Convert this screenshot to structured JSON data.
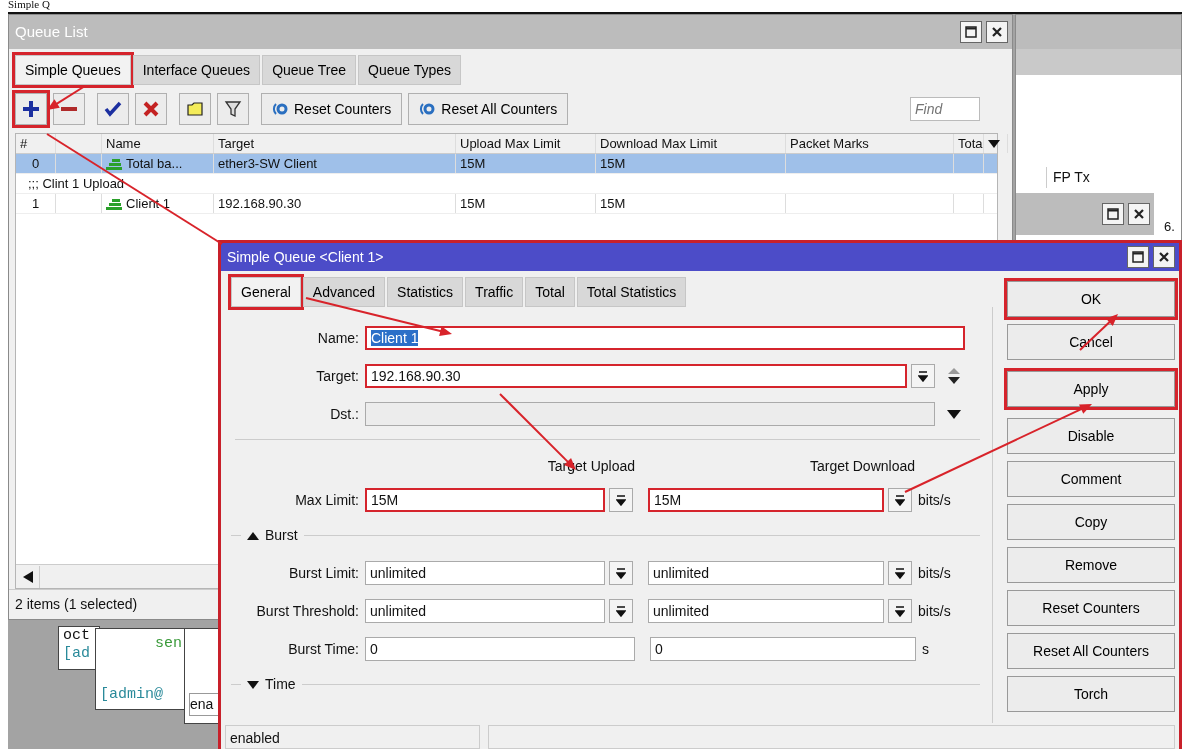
{
  "page_heading": "Simple Q",
  "queue_list": {
    "title": "Queue List",
    "tabs": [
      {
        "label": "Simple Queues",
        "selected": true,
        "highlighted": true
      },
      {
        "label": "Interface Queues",
        "selected": false,
        "highlighted": false
      },
      {
        "label": "Queue Tree",
        "selected": false,
        "highlighted": false
      },
      {
        "label": "Queue Types",
        "selected": false,
        "highlighted": false
      }
    ],
    "tools": [
      {
        "kind": "add",
        "highlighted": true
      },
      {
        "kind": "remove",
        "highlighted": false
      },
      {
        "kind": "enable",
        "highlighted": false
      },
      {
        "kind": "disable",
        "highlighted": false
      },
      {
        "kind": "comment",
        "highlighted": false
      },
      {
        "kind": "filter",
        "highlighted": false
      }
    ],
    "actions": [
      "Reset Counters",
      "Reset All Counters"
    ],
    "find": {
      "placeholder": "Find"
    },
    "columns": [
      "#",
      "Name",
      "Target",
      "Upload Max Limit",
      "Download Max Limit",
      "Packet Marks",
      "Tota"
    ],
    "rows": [
      {
        "kind": "entry",
        "number": "0",
        "name": "Total ba...",
        "target": "ether3-SW Client",
        "upload": "15M",
        "download": "15M",
        "selected": true
      },
      {
        "kind": "comment",
        "text": ";;; Clint 1 Upload",
        "selected": false
      },
      {
        "kind": "entry",
        "number": "1",
        "name": "Client 1",
        "target": "192.168.90.30",
        "upload": "15M",
        "download": "15M",
        "selected": false
      }
    ],
    "status": "2 items (1 selected)"
  },
  "side_window": {
    "column": "FP Tx",
    "value": "6."
  },
  "background_windows": [
    {
      "lines": [
        "oct",
        "[ad"
      ]
    },
    {
      "lines": [
        "sen",
        "[admin@"
      ]
    },
    {
      "lines": [
        "ena"
      ]
    }
  ],
  "dialog": {
    "title": "Simple Queue <Client 1>",
    "tabs": [
      {
        "label": "General",
        "selected": true,
        "highlighted": true
      },
      {
        "label": "Advanced",
        "selected": false,
        "highlighted": false
      },
      {
        "label": "Statistics",
        "selected": false,
        "highlighted": false
      },
      {
        "label": "Traffic",
        "selected": false,
        "highlighted": false
      },
      {
        "label": "Total",
        "selected": false,
        "highlighted": false
      },
      {
        "label": "Total Statistics",
        "selected": false,
        "highlighted": false
      }
    ],
    "fields": [
      {
        "kind": "text",
        "label": "Name:",
        "value": "Client 1",
        "highlighted": true,
        "text_selected": true
      },
      {
        "kind": "dropdown",
        "label": "Target:",
        "value": "192.168.90.30",
        "highlighted": true,
        "text_selected": false
      },
      {
        "kind": "select",
        "label": "Dst.:",
        "highlighted": false
      }
    ],
    "limit_headers": [
      "Target Upload",
      "Target Download"
    ],
    "max_limit": {
      "label": "Max Limit:",
      "upload": "15M",
      "download": "15M",
      "unit": "bits/s",
      "highlighted": true
    },
    "burst": {
      "label": "Burst",
      "expanded": true,
      "rows": [
        {
          "kind": "dropdown",
          "label": "Burst Limit:",
          "upload": "unlimited",
          "download": "unlimited",
          "unit": "bits/s"
        },
        {
          "kind": "dropdown",
          "label": "Burst Threshold:",
          "upload": "unlimited",
          "download": "unlimited",
          "unit": "bits/s"
        },
        {
          "kind": "plain",
          "label": "Burst Time:",
          "upload": "0",
          "download": "0",
          "unit": "s"
        }
      ]
    },
    "time": {
      "label": "Time",
      "expanded": false
    },
    "buttons": [
      {
        "label": "OK",
        "highlighted": true
      },
      {
        "label": "Cancel",
        "highlighted": false
      },
      {
        "label": "Apply",
        "highlighted": true
      },
      {
        "label": "Disable",
        "highlighted": false
      },
      {
        "label": "Comment",
        "highlighted": false
      },
      {
        "label": "Copy",
        "highlighted": false
      },
      {
        "label": "Remove",
        "highlighted": false
      },
      {
        "label": "Reset Counters",
        "highlighted": false
      },
      {
        "label": "Reset All Counters",
        "highlighted": false
      },
      {
        "label": "Torch",
        "highlighted": false
      }
    ],
    "status": "enabled"
  }
}
